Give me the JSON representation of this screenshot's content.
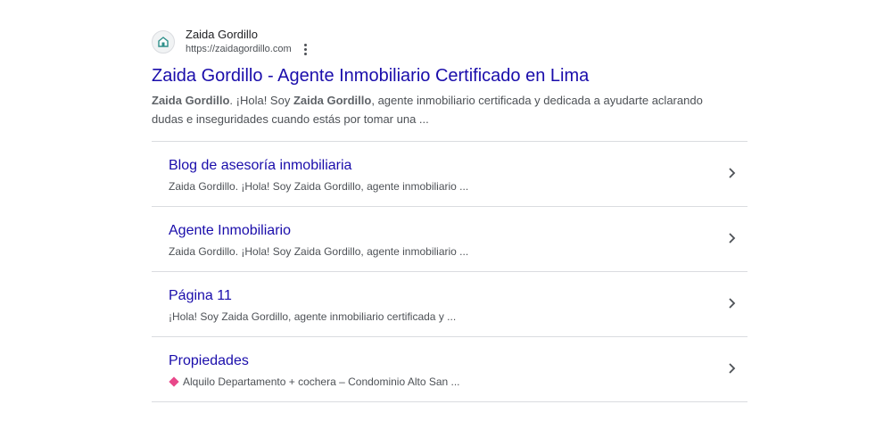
{
  "site": {
    "name": "Zaida Gordillo",
    "url": "https://zaidagordillo.com",
    "favicon_icon": "house-logo-icon",
    "menu_icon": "more-vert-icon"
  },
  "result": {
    "title": "Zaida Gordillo - Agente Inmobiliario Certificado en Lima",
    "snippet": {
      "part1_bold": "Zaida Gordillo",
      "part2": ". ¡Hola! Soy ",
      "part3_bold": "Zaida Gordillo",
      "part4": ", agente inmobiliario certificada y dedicada a ayudarte aclarando dudas e inseguridades cuando estás por tomar una ..."
    }
  },
  "sitelinks": [
    {
      "title": "Blog de asesoría inmobiliaria",
      "description": "Zaida Gordillo. ¡Hola! Soy Zaida Gordillo, agente inmobiliario ..."
    },
    {
      "title": "Agente Inmobiliario",
      "description": "Zaida Gordillo. ¡Hola! Soy Zaida Gordillo, agente inmobiliario ..."
    },
    {
      "title": "Página 11",
      "description": "¡Hola! Soy Zaida Gordillo, agente inmobiliario certificada y ..."
    },
    {
      "title": "Propiedades",
      "description": "Alquilo Departamento + cochera – Condominio Alto San ...",
      "prefix_icon": "pink-diamond-icon"
    }
  ],
  "colors": {
    "link": "#1a0dab",
    "text": "#4d5156",
    "divider": "#dadce0",
    "diamond": "#e8488a"
  }
}
